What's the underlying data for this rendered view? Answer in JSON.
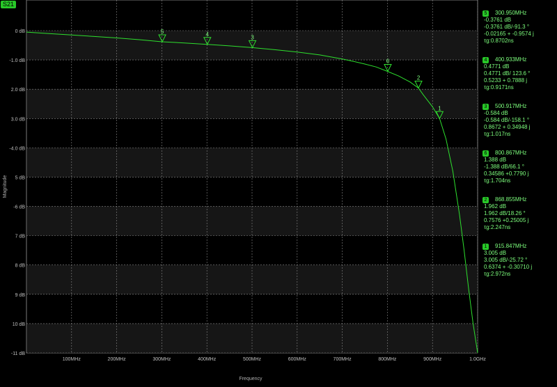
{
  "trace_name": "S21",
  "chart_data": {
    "type": "line",
    "xlabel": "Frequency",
    "ylabel": "Magnitude",
    "xlim": [
      0,
      1000
    ],
    "ylim": [
      -11,
      0
    ],
    "grid": true,
    "x_ticks": [
      {
        "v": 100,
        "label": "100MHz"
      },
      {
        "v": 200,
        "label": "200MHz"
      },
      {
        "v": 300,
        "label": "300MHz"
      },
      {
        "v": 400,
        "label": "400MHz"
      },
      {
        "v": 500,
        "label": "500MHz"
      },
      {
        "v": 600,
        "label": "600MHz"
      },
      {
        "v": 700,
        "label": "700MHz"
      },
      {
        "v": 800,
        "label": "800MHz"
      },
      {
        "v": 900,
        "label": "900MHz"
      },
      {
        "v": 1000,
        "label": "1.0GHz"
      }
    ],
    "y_ticks": [
      {
        "v": 0,
        "label": "0 dB"
      },
      {
        "v": -1,
        "label": "-1.0 dB"
      },
      {
        "v": -2,
        "label": "2.0 dB"
      },
      {
        "v": -3,
        "label": "3.0 dB"
      },
      {
        "v": -4,
        "label": "-4.0 dB"
      },
      {
        "v": -5,
        "label": "5 dB"
      },
      {
        "v": -6,
        "label": "-6 dB"
      },
      {
        "v": -7,
        "label": "7 dB"
      },
      {
        "v": -8,
        "label": "8 dB"
      },
      {
        "v": -9,
        "label": "9 dB"
      },
      {
        "v": -10,
        "label": "10 dB"
      },
      {
        "v": -11,
        "label": "-11 dB"
      }
    ],
    "series": [
      {
        "x": [
          0,
          50,
          100,
          150,
          200,
          250,
          300,
          350,
          400,
          450,
          500,
          550,
          600,
          650,
          700,
          725,
          750,
          775,
          800,
          825,
          850,
          868.9,
          880,
          900,
          915.8,
          930,
          945,
          960,
          970,
          980,
          990,
          1000
        ],
        "y": [
          -0.05,
          -0.1,
          -0.15,
          -0.2,
          -0.25,
          -0.31,
          -0.38,
          -0.42,
          -0.47,
          -0.52,
          -0.58,
          -0.65,
          -0.73,
          -0.83,
          -0.97,
          -1.05,
          -1.14,
          -1.24,
          -1.39,
          -1.55,
          -1.75,
          -1.96,
          -2.2,
          -2.6,
          -3.0,
          -3.7,
          -4.8,
          -6.3,
          -7.5,
          -8.8,
          -10.0,
          -11.0
        ]
      }
    ],
    "markers": [
      {
        "id": "1",
        "x": 915.8,
        "y": -3.0
      },
      {
        "id": "2",
        "x": 868.9,
        "y": -1.96
      },
      {
        "id": "3",
        "x": 500.9,
        "y": -0.58
      },
      {
        "id": "4",
        "x": 400.9,
        "y": -0.47
      },
      {
        "id": "5",
        "x": 301.0,
        "y": -0.38
      },
      {
        "id": "6",
        "x": 800.9,
        "y": -1.39
      }
    ]
  },
  "marker_readouts": [
    {
      "badge": "5",
      "freq": "300.950MHz",
      "lines": [
        "-0.3761 dB",
        "-0.3761 dB/-91.3 °",
        "-0.02165 + -0.9574 j",
        "τg:0.8702ns"
      ]
    },
    {
      "badge": "4",
      "freq": "400.933MHz",
      "lines": [
        "0.4771 dB",
        "0.4771 dB/ 123.6 °",
        "0.5233 + 0.7888 j",
        "τg:0.9171ns"
      ]
    },
    {
      "badge": "3",
      "freq": "500.917MHz",
      "lines": [
        "-0.584 dB",
        "-0.584 dB/-158.1 °",
        "0.8672 + 0.34948 j",
        "τg:1.017ns"
      ]
    },
    {
      "badge": "6",
      "freq": "800.867MHz",
      "lines": [
        "1.388 dB",
        "-1.388 dB/66.1 °",
        "0.34586 +0.7790 j",
        "τg:1.704ns"
      ]
    },
    {
      "badge": "2",
      "freq": "868.855MHz",
      "lines": [
        "1.962 dB",
        "1.962 dB/18.26 °",
        "0.7576 +0.25005 j",
        "τg:2.247ns"
      ]
    },
    {
      "badge": "1",
      "freq": "915.847MHz",
      "lines": [
        "3.005 dB",
        "3.005 dB/-25.72 °",
        "0.6374 + -0.30710 j",
        "τg:2.972ns"
      ]
    }
  ]
}
